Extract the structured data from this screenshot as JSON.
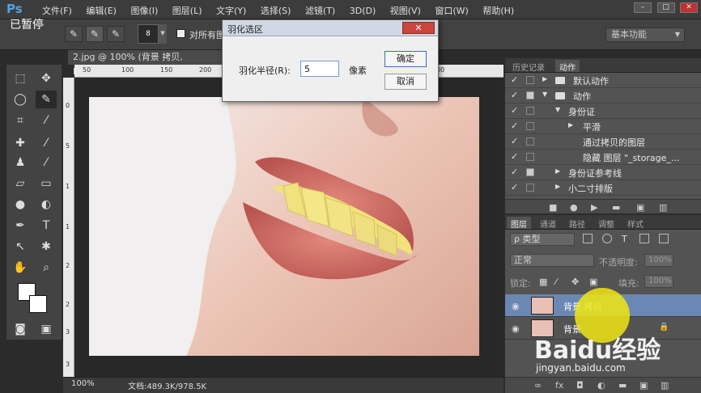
{
  "app": {
    "logo": "Ps",
    "menus": [
      "文件(F)",
      "编辑(E)",
      "图像(I)",
      "图层(L)",
      "文字(Y)",
      "选择(S)",
      "滤镜(T)",
      "3D(D)",
      "视图(V)",
      "窗口(W)",
      "帮助(H)"
    ],
    "window_controls": [
      "–",
      "□",
      "✕"
    ]
  },
  "options_bar": {
    "pause_label": "已暂停",
    "brush_size": "8",
    "sample_all_label": "对所有图",
    "workspace": "基本功能"
  },
  "document": {
    "tab_title": "2.jpg @ 100% (背景 拷贝, RGB/8#)",
    "zoom": "100%",
    "doc_info": "文档:489.3K/978.5K",
    "ruler_top": [
      "50",
      "100",
      "150",
      "200",
      "250",
      "300",
      "350",
      "400",
      "450",
      "500"
    ],
    "ruler_left": [
      "0",
      "5",
      "1",
      "1",
      "2",
      "2",
      "3",
      "3"
    ]
  },
  "dialog": {
    "title": "羽化选区",
    "close": "✕",
    "radius_label": "羽化半径(R):",
    "radius_value": "5",
    "unit": "像素",
    "ok_label": "确定",
    "cancel_label": "取消"
  },
  "history_panel": {
    "tabs": [
      "历史记录",
      "动作"
    ],
    "actions": [
      {
        "checked": "✓",
        "label": "默认动作",
        "type": "set"
      },
      {
        "checked": "✓",
        "label": "动作",
        "type": "set"
      },
      {
        "checked": "✓",
        "label": "身份证",
        "type": "action"
      },
      {
        "checked": "✓",
        "label": "平滑",
        "type": "step"
      },
      {
        "checked": "✓",
        "label": "通过拷贝的图层",
        "type": "step"
      },
      {
        "checked": "✓",
        "label": "隐藏 图层 \"_storage_...",
        "type": "step"
      },
      {
        "checked": "✓",
        "label": "身份证参考线",
        "type": "action"
      },
      {
        "checked": "✓",
        "label": "小二寸排版",
        "type": "action"
      }
    ],
    "footer_icons": [
      "stop-icon",
      "record-icon",
      "play-icon",
      "new-set-icon",
      "new-action-icon",
      "delete-icon"
    ]
  },
  "layers_panel": {
    "tabs": [
      "图层",
      "通道",
      "路径",
      "调整",
      "样式"
    ],
    "filter": "ρ 类型",
    "blend_mode": "正常",
    "opacity_label": "不透明度:",
    "opacity_value": "100%",
    "lock_label": "锁定:",
    "fill_label": "填充:",
    "fill_value": "100%",
    "layers": [
      {
        "name": "背景 拷贝",
        "selected": true,
        "locked": false
      },
      {
        "name": "背景",
        "selected": false,
        "locked": true
      }
    ]
  },
  "watermark": {
    "logo": "Baidu经验",
    "url": "jingyan.baidu.com"
  }
}
